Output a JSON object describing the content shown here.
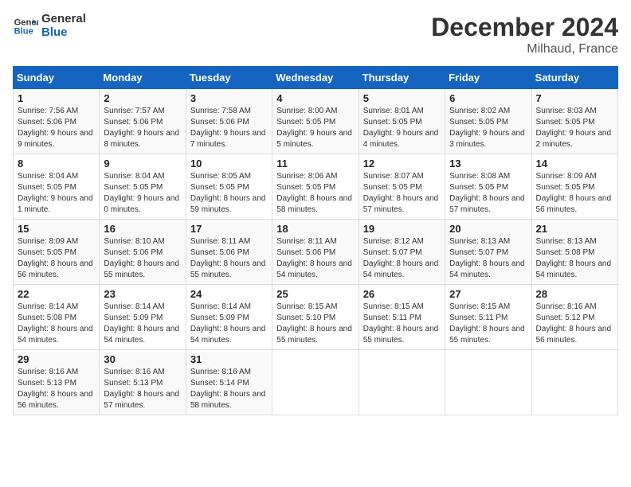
{
  "header": {
    "logo_line1": "General",
    "logo_line2": "Blue",
    "title": "December 2024",
    "subtitle": "Milhaud, France"
  },
  "days_of_week": [
    "Sunday",
    "Monday",
    "Tuesday",
    "Wednesday",
    "Thursday",
    "Friday",
    "Saturday"
  ],
  "weeks": [
    [
      {
        "day": "1",
        "info": "Sunrise: 7:56 AM\nSunset: 5:06 PM\nDaylight: 9 hours and 9 minutes."
      },
      {
        "day": "2",
        "info": "Sunrise: 7:57 AM\nSunset: 5:06 PM\nDaylight: 9 hours and 8 minutes."
      },
      {
        "day": "3",
        "info": "Sunrise: 7:58 AM\nSunset: 5:06 PM\nDaylight: 9 hours and 7 minutes."
      },
      {
        "day": "4",
        "info": "Sunrise: 8:00 AM\nSunset: 5:05 PM\nDaylight: 9 hours and 5 minutes."
      },
      {
        "day": "5",
        "info": "Sunrise: 8:01 AM\nSunset: 5:05 PM\nDaylight: 9 hours and 4 minutes."
      },
      {
        "day": "6",
        "info": "Sunrise: 8:02 AM\nSunset: 5:05 PM\nDaylight: 9 hours and 3 minutes."
      },
      {
        "day": "7",
        "info": "Sunrise: 8:03 AM\nSunset: 5:05 PM\nDaylight: 9 hours and 2 minutes."
      }
    ],
    [
      {
        "day": "8",
        "info": "Sunrise: 8:04 AM\nSunset: 5:05 PM\nDaylight: 9 hours and 1 minute."
      },
      {
        "day": "9",
        "info": "Sunrise: 8:04 AM\nSunset: 5:05 PM\nDaylight: 9 hours and 0 minutes."
      },
      {
        "day": "10",
        "info": "Sunrise: 8:05 AM\nSunset: 5:05 PM\nDaylight: 8 hours and 59 minutes."
      },
      {
        "day": "11",
        "info": "Sunrise: 8:06 AM\nSunset: 5:05 PM\nDaylight: 8 hours and 58 minutes."
      },
      {
        "day": "12",
        "info": "Sunrise: 8:07 AM\nSunset: 5:05 PM\nDaylight: 8 hours and 57 minutes."
      },
      {
        "day": "13",
        "info": "Sunrise: 8:08 AM\nSunset: 5:05 PM\nDaylight: 8 hours and 57 minutes."
      },
      {
        "day": "14",
        "info": "Sunrise: 8:09 AM\nSunset: 5:05 PM\nDaylight: 8 hours and 56 minutes."
      }
    ],
    [
      {
        "day": "15",
        "info": "Sunrise: 8:09 AM\nSunset: 5:05 PM\nDaylight: 8 hours and 56 minutes."
      },
      {
        "day": "16",
        "info": "Sunrise: 8:10 AM\nSunset: 5:06 PM\nDaylight: 8 hours and 55 minutes."
      },
      {
        "day": "17",
        "info": "Sunrise: 8:11 AM\nSunset: 5:06 PM\nDaylight: 8 hours and 55 minutes."
      },
      {
        "day": "18",
        "info": "Sunrise: 8:11 AM\nSunset: 5:06 PM\nDaylight: 8 hours and 54 minutes."
      },
      {
        "day": "19",
        "info": "Sunrise: 8:12 AM\nSunset: 5:07 PM\nDaylight: 8 hours and 54 minutes."
      },
      {
        "day": "20",
        "info": "Sunrise: 8:13 AM\nSunset: 5:07 PM\nDaylight: 8 hours and 54 minutes."
      },
      {
        "day": "21",
        "info": "Sunrise: 8:13 AM\nSunset: 5:08 PM\nDaylight: 8 hours and 54 minutes."
      }
    ],
    [
      {
        "day": "22",
        "info": "Sunrise: 8:14 AM\nSunset: 5:08 PM\nDaylight: 8 hours and 54 minutes."
      },
      {
        "day": "23",
        "info": "Sunrise: 8:14 AM\nSunset: 5:09 PM\nDaylight: 8 hours and 54 minutes."
      },
      {
        "day": "24",
        "info": "Sunrise: 8:14 AM\nSunset: 5:09 PM\nDaylight: 8 hours and 54 minutes."
      },
      {
        "day": "25",
        "info": "Sunrise: 8:15 AM\nSunset: 5:10 PM\nDaylight: 8 hours and 55 minutes."
      },
      {
        "day": "26",
        "info": "Sunrise: 8:15 AM\nSunset: 5:11 PM\nDaylight: 8 hours and 55 minutes."
      },
      {
        "day": "27",
        "info": "Sunrise: 8:15 AM\nSunset: 5:11 PM\nDaylight: 8 hours and 55 minutes."
      },
      {
        "day": "28",
        "info": "Sunrise: 8:16 AM\nSunset: 5:12 PM\nDaylight: 8 hours and 56 minutes."
      }
    ],
    [
      {
        "day": "29",
        "info": "Sunrise: 8:16 AM\nSunset: 5:13 PM\nDaylight: 8 hours and 56 minutes."
      },
      {
        "day": "30",
        "info": "Sunrise: 8:16 AM\nSunset: 5:13 PM\nDaylight: 8 hours and 57 minutes."
      },
      {
        "day": "31",
        "info": "Sunrise: 8:16 AM\nSunset: 5:14 PM\nDaylight: 8 hours and 58 minutes."
      },
      {
        "day": "",
        "info": ""
      },
      {
        "day": "",
        "info": ""
      },
      {
        "day": "",
        "info": ""
      },
      {
        "day": "",
        "info": ""
      }
    ]
  ]
}
